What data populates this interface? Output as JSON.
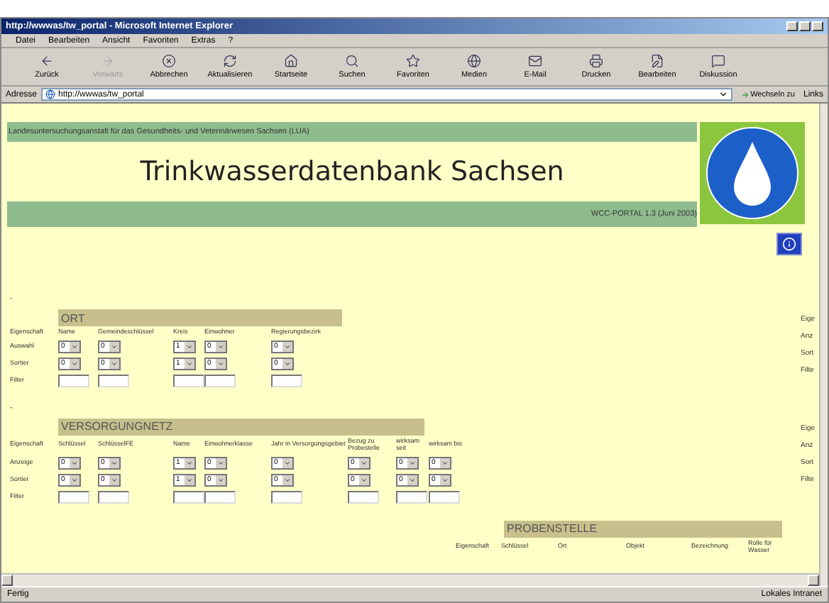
{
  "window": {
    "title": "http://wwwas/tw_portal - Microsoft Internet Explorer"
  },
  "menu": [
    "Datei",
    "Bearbeiten",
    "Ansicht",
    "Favoriten",
    "Extras",
    "?"
  ],
  "toolbar": [
    {
      "label": "Zurück",
      "disabled": false
    },
    {
      "label": "Vorwärts",
      "disabled": true
    },
    {
      "label": "Abbrechen",
      "disabled": false
    },
    {
      "label": "Aktualisieren",
      "disabled": false
    },
    {
      "label": "Startseite",
      "disabled": false
    },
    {
      "label": "Suchen",
      "disabled": false
    },
    {
      "label": "Favoriten",
      "disabled": false
    },
    {
      "label": "Medien",
      "disabled": false
    },
    {
      "label": "E-Mail",
      "disabled": false
    },
    {
      "label": "Drucken",
      "disabled": false
    },
    {
      "label": "Bearbeiten",
      "disabled": false
    },
    {
      "label": "Diskussion",
      "disabled": false
    }
  ],
  "address": {
    "label": "Adresse",
    "url": "http://wwwas/tw_portal",
    "go": "Wechseln zu",
    "links": "Links"
  },
  "header": {
    "agency": "Landesuntersuchungsanstalt für das Gesundheits- und Veterinärwesen Sachsen (LUA)",
    "title": "Trinkwasserdatenbank Sachsen",
    "version": "WCC-PORTAL 1.3 (Juni 2003)"
  },
  "sections": [
    {
      "title": "ORT",
      "dash": "-",
      "property": "Eigenschaft",
      "columns": [
        "Name",
        "Gemeindeschlüssel",
        "Kreis",
        "Einwohner",
        "Regierungsbezirk"
      ],
      "rows": [
        {
          "label": "Auswahl",
          "kind": "select",
          "values": [
            "0",
            "0",
            "1",
            "0",
            "0"
          ]
        },
        {
          "label": "Sortier",
          "kind": "select",
          "values": [
            "0",
            "0",
            "1",
            "0",
            "0"
          ]
        },
        {
          "label": "Filter",
          "kind": "input"
        }
      ],
      "overflow": [
        "Eige",
        "Anz",
        "Sort",
        "Filte"
      ]
    },
    {
      "title": "VERSORGUNGNETZ",
      "dash": "-",
      "property": "Eigenschaft",
      "columns": [
        "Schlüssel",
        "SchlüsselFE",
        "Name",
        "Einwohnerklasse",
        "Jahr in Versorgungsgebiet",
        "Bezug zu Probestelle",
        "wirksam seit",
        "wirksam bis"
      ],
      "rows": [
        {
          "label": "Anzeige",
          "kind": "select",
          "values": [
            "0",
            "0",
            "1",
            "0",
            "0",
            "0",
            "0",
            "0"
          ]
        },
        {
          "label": "Sortier",
          "kind": "select",
          "values": [
            "0",
            "0",
            "1",
            "0",
            "0",
            "0",
            "0",
            "0"
          ]
        },
        {
          "label": "Filter",
          "kind": "input"
        }
      ],
      "overflow": [
        "Eige",
        "Anz",
        "Sort",
        "Filte"
      ]
    },
    {
      "title": "PROBENSTELLE",
      "property": "Eigenschaft",
      "columns": [
        "Schlüssel",
        "Ort",
        "Objekt",
        "Bezeichnung",
        "Rolle für Wasser"
      ]
    }
  ],
  "status": {
    "text": "Fertig",
    "zone": "Lokales Intranet"
  }
}
